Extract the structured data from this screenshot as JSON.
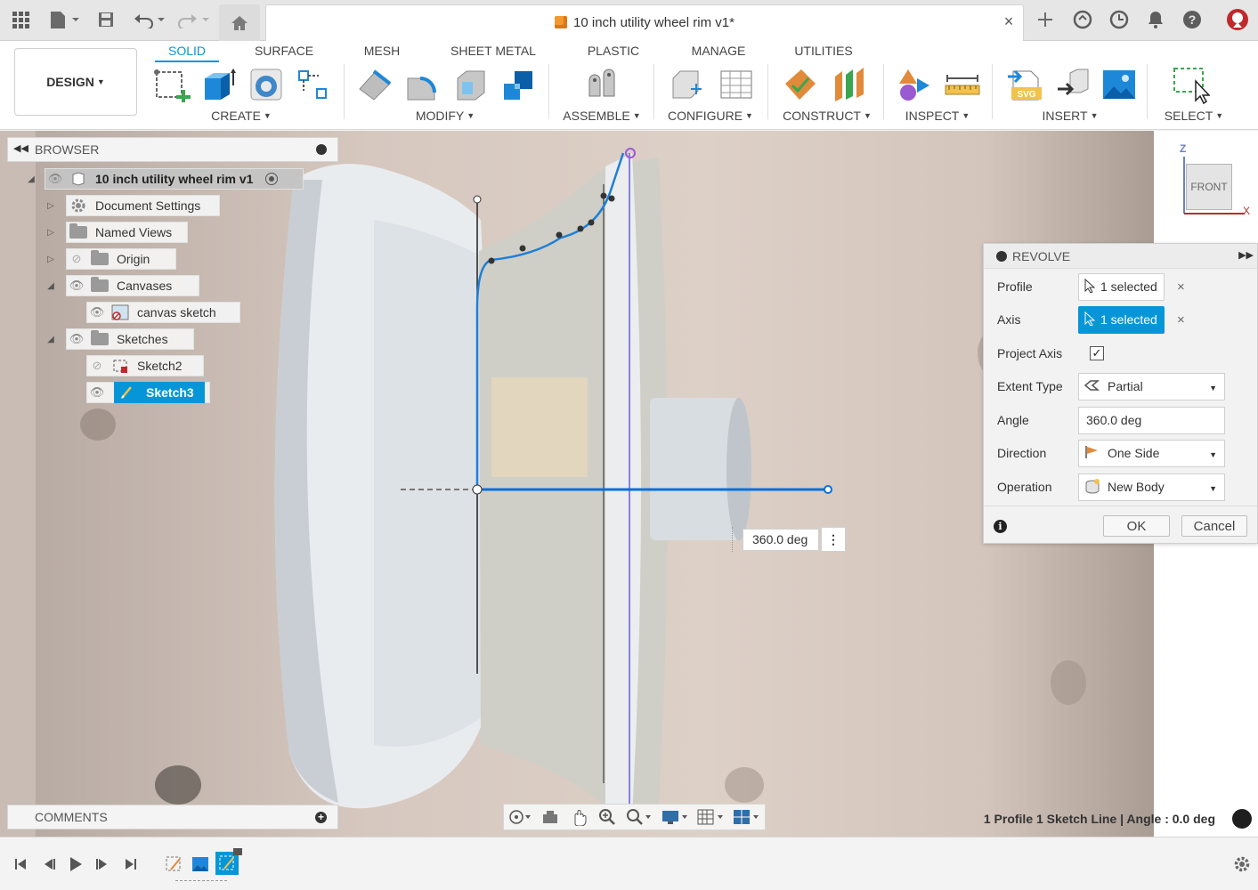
{
  "titlebar": {
    "document_title": "10 inch utility wheel rim v1*",
    "close_glyph": "×"
  },
  "toolbar": {
    "workspace": "DESIGN",
    "tabs": [
      "SOLID",
      "SURFACE",
      "MESH",
      "SHEET METAL",
      "PLASTIC",
      "MANAGE",
      "UTILITIES"
    ],
    "active_tab": "SOLID",
    "groups": [
      "CREATE",
      "MODIFY",
      "ASSEMBLE",
      "CONFIGURE",
      "CONSTRUCT",
      "INSPECT",
      "INSERT",
      "SELECT"
    ],
    "accent": "#0696d7"
  },
  "browser": {
    "title": "BROWSER",
    "root": "10 inch utility wheel rim v1",
    "items": [
      {
        "label": "Document Settings",
        "icon": "gear-icon"
      },
      {
        "label": "Named Views",
        "icon": "folder-icon"
      },
      {
        "label": "Origin",
        "icon": "folder-icon"
      },
      {
        "label": "Canvases",
        "icon": "folder-icon"
      },
      {
        "label": "canvas sketch",
        "icon": "canvas-icon"
      },
      {
        "label": "Sketches",
        "icon": "folder-icon"
      },
      {
        "label": "Sketch2",
        "icon": "sketch-icon"
      },
      {
        "label": "Sketch3",
        "icon": "sketch-icon"
      }
    ]
  },
  "comments": {
    "title": "COMMENTS"
  },
  "viewcube": {
    "face": "FRONT",
    "axis_z": "Z",
    "axis_x": "X"
  },
  "revolve": {
    "title": "REVOLVE",
    "profile_label": "Profile",
    "profile_value": "1 selected",
    "axis_label": "Axis",
    "axis_value": "1 selected",
    "project_axis_label": "Project Axis",
    "project_axis_checked": "✓",
    "extent_label": "Extent Type",
    "extent_value": "Partial",
    "angle_label": "Angle",
    "angle_value": "360.0 deg",
    "direction_label": "Direction",
    "direction_value": "One Side",
    "operation_label": "Operation",
    "operation_value": "New Body",
    "ok": "OK",
    "cancel": "Cancel",
    "clear": "×"
  },
  "viewport": {
    "angle_readout": "360.0 deg",
    "status": "1 Profile 1 Sketch Line | Angle : 0.0 deg"
  }
}
